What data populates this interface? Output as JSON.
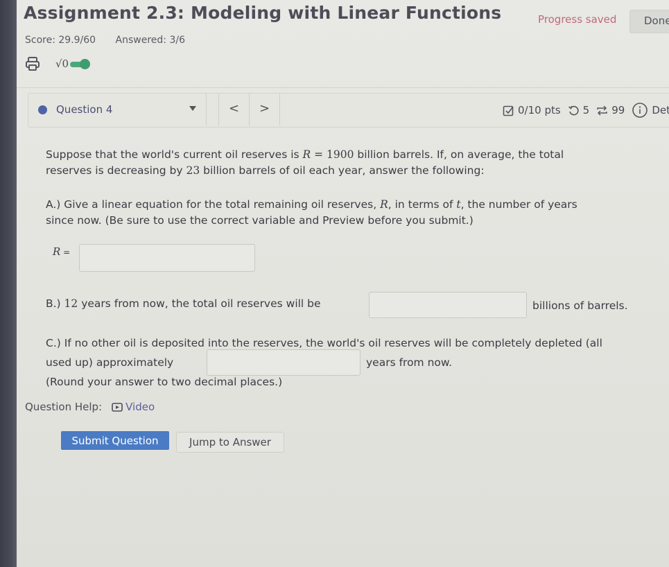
{
  "header": {
    "title": "Assignment 2.3: Modeling with Linear Functions",
    "progress_status": "Progress saved",
    "done_label": "Done",
    "score": "Score: 29.9/60",
    "answered": "Answered: 3/6",
    "icons": [
      "print-icon",
      "sqrt-math-toggle-icon"
    ],
    "sqrt_label": "√0",
    "math_toggle_on": true
  },
  "question_bar": {
    "selected_question": "Question 4",
    "prev_label": "<",
    "next_label": ">",
    "points": "0/10 pts",
    "retries": "5",
    "attempts": "99",
    "details_label": "Det",
    "status_color": "#4f63a8"
  },
  "question": {
    "intro_part1": "Suppose that the world's current oil reserves is ",
    "intro_var": "R",
    "intro_eq": " = 1900",
    "intro_part2": " billion barrels. If, on average, the total",
    "intro_line2_a": "reserves is decreasing by ",
    "intro_rate": "23",
    "intro_line2_b": " billion barrels of oil each year, answer the following:",
    "partA_line1_a": "A.) Give a linear equation for the total remaining oil reserves, ",
    "partA_var_R": "R",
    "partA_line1_b": ", in terms of ",
    "partA_var_t": "t",
    "partA_line1_c": ", the number of years",
    "partA_line2": "since now. (Be sure to use the correct variable and Preview before you submit.)",
    "partA_input_label_var": "R",
    "partA_input_label_eq": " =",
    "partA_value": "",
    "partB_a": "B.) ",
    "partB_years": "12",
    "partB_b": " years from now, the total oil reserves will be",
    "partB_value": "",
    "partB_suffix": "billions of barrels.",
    "partC_line1": "C.) If no other oil is deposited into the reserves, the world's oil reserves will be completely depleted (all",
    "partC_prefix": "used up) approximately",
    "partC_value": "",
    "partC_suffix": "years from now.",
    "partC_note": "(Round your answer to two decimal places.)"
  },
  "help": {
    "label": "Question Help:",
    "video_label": "Video"
  },
  "actions": {
    "submit_label": "Submit Question",
    "jump_label": "Jump to Answer"
  },
  "colors": {
    "accent": "#4a7bc4",
    "progress_text": "#c06a7a",
    "toggle": "#4fa67d"
  }
}
